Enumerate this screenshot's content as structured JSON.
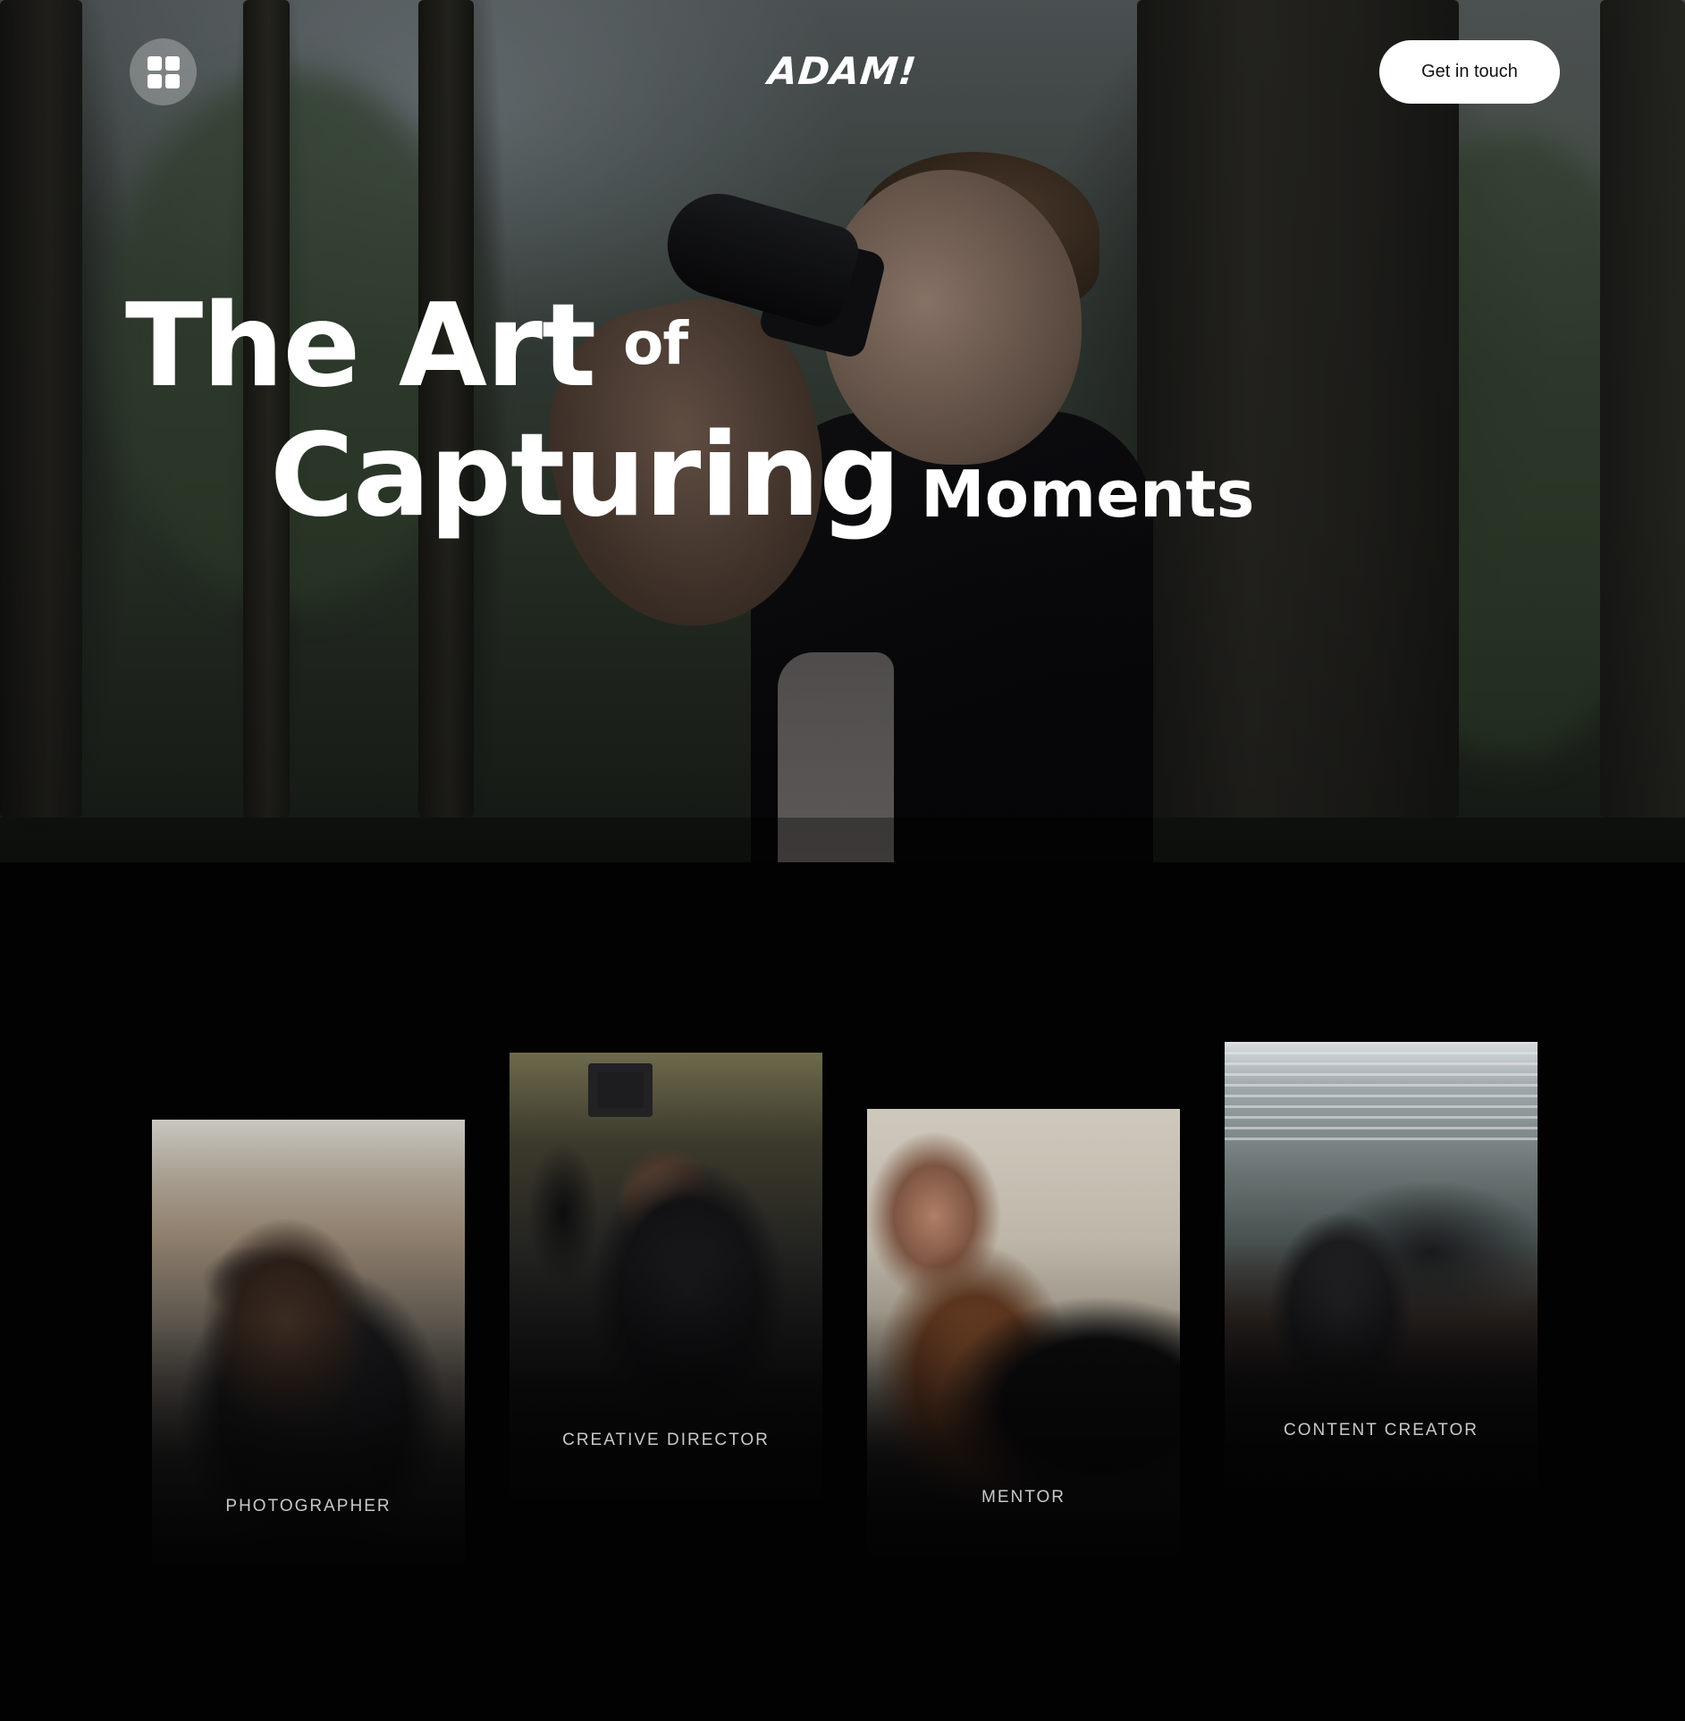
{
  "header": {
    "menu_icon": "grid-icon",
    "logo_text": "ADAM!",
    "cta_label": "Get in touch"
  },
  "hero": {
    "headline": {
      "line1_main": "The Art",
      "line1_small": "of",
      "line2_main": "Capturing",
      "line2_small": "Moments"
    }
  },
  "roles": [
    {
      "label": "PHOTOGRAPHER"
    },
    {
      "label": "CREATIVE DIRECTOR"
    },
    {
      "label": "MENTOR"
    },
    {
      "label": "CONTENT CREATOR"
    }
  ],
  "colors": {
    "page_background": "#020203",
    "button_background": "#ffffff",
    "button_text": "#111111",
    "headline": "#ffffff",
    "role_label": "#c9c9c9"
  }
}
